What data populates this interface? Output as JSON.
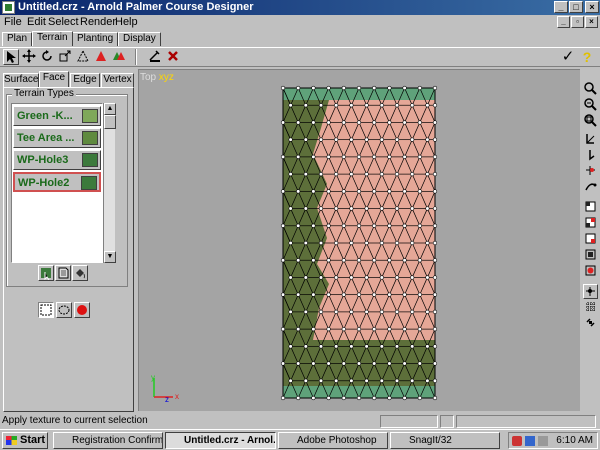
{
  "window": {
    "title": "Untitled.crz - Arnold Palmer Course Designer",
    "minimize_glyph": "_",
    "maximize_glyph": "□",
    "close_glyph": "×"
  },
  "menubar": {
    "items": [
      "File",
      "Edit",
      "Select",
      "Render",
      "Help"
    ]
  },
  "main_tabs": [
    "Plan",
    "Terrain",
    "Planting",
    "Display"
  ],
  "active_main_tab": "Terrain",
  "toolbar": {
    "tools": [
      "select-arrow-icon",
      "move-cross-icon",
      "rotate-icon",
      "scale-icon",
      "triangle-outline-icon",
      "triangle-red-icon",
      "triangle-multi-icon",
      "paste-icon",
      "delete-x-icon"
    ],
    "ok_glyph": "✓",
    "help_glyph": "?"
  },
  "left_panel": {
    "subtabs": [
      "Surface",
      "Face",
      "Edge",
      "Vertex"
    ],
    "active_subtab": "Face",
    "terrain_types_label": "Terrain Types",
    "terrain_types": [
      {
        "label": "Green -K...",
        "swatch": "#7fa85a"
      },
      {
        "label": "Tee Area ...",
        "swatch": "#5f8a3f"
      },
      {
        "label": "WP-Hole3",
        "swatch": "#3c7a3c"
      },
      {
        "label": "WP-Hole2",
        "swatch": "#3c7a3c"
      }
    ],
    "selected_terrain": "WP-Hole2",
    "action_buttons": [
      "apply-texture-icon",
      "texture-page-icon",
      "paint-bucket-icon"
    ],
    "selection_buttons": [
      "select-rect-icon",
      "select-lasso-icon",
      "select-all-icon"
    ]
  },
  "viewport": {
    "view_name": "Top",
    "axis_label": "xyz",
    "colors": {
      "background": "#a4a4a4",
      "grass": "#5d6f3a",
      "selected_face": "#e5a797",
      "border_strip": "#5fa27a",
      "mesh_line": "#000000",
      "vertex": "#ffffff"
    }
  },
  "right_toolbar": {
    "tools": [
      "zoom-in-icon",
      "zoom-out-icon",
      "zoom-fit-icon",
      "rotate-view-icon",
      "pan-icon",
      "orbit-icon",
      "walk-icon",
      "view-top-icon",
      "view-front-icon",
      "view-side-icon",
      "view-persp-icon",
      "view-camera-icon",
      "snap-icon",
      "grid-icon",
      "link-icon"
    ]
  },
  "status": {
    "text": "Apply texture to current selection"
  },
  "taskbar": {
    "start_label": "Start",
    "tasks": [
      {
        "label": "Registration Confirmatio...",
        "active": false
      },
      {
        "label": "Untitled.crz - Arnol...",
        "active": true
      },
      {
        "label": "Adobe Photoshop",
        "active": false
      },
      {
        "label": "SnagIt/32",
        "active": false
      }
    ],
    "clock": "6:10 AM"
  }
}
